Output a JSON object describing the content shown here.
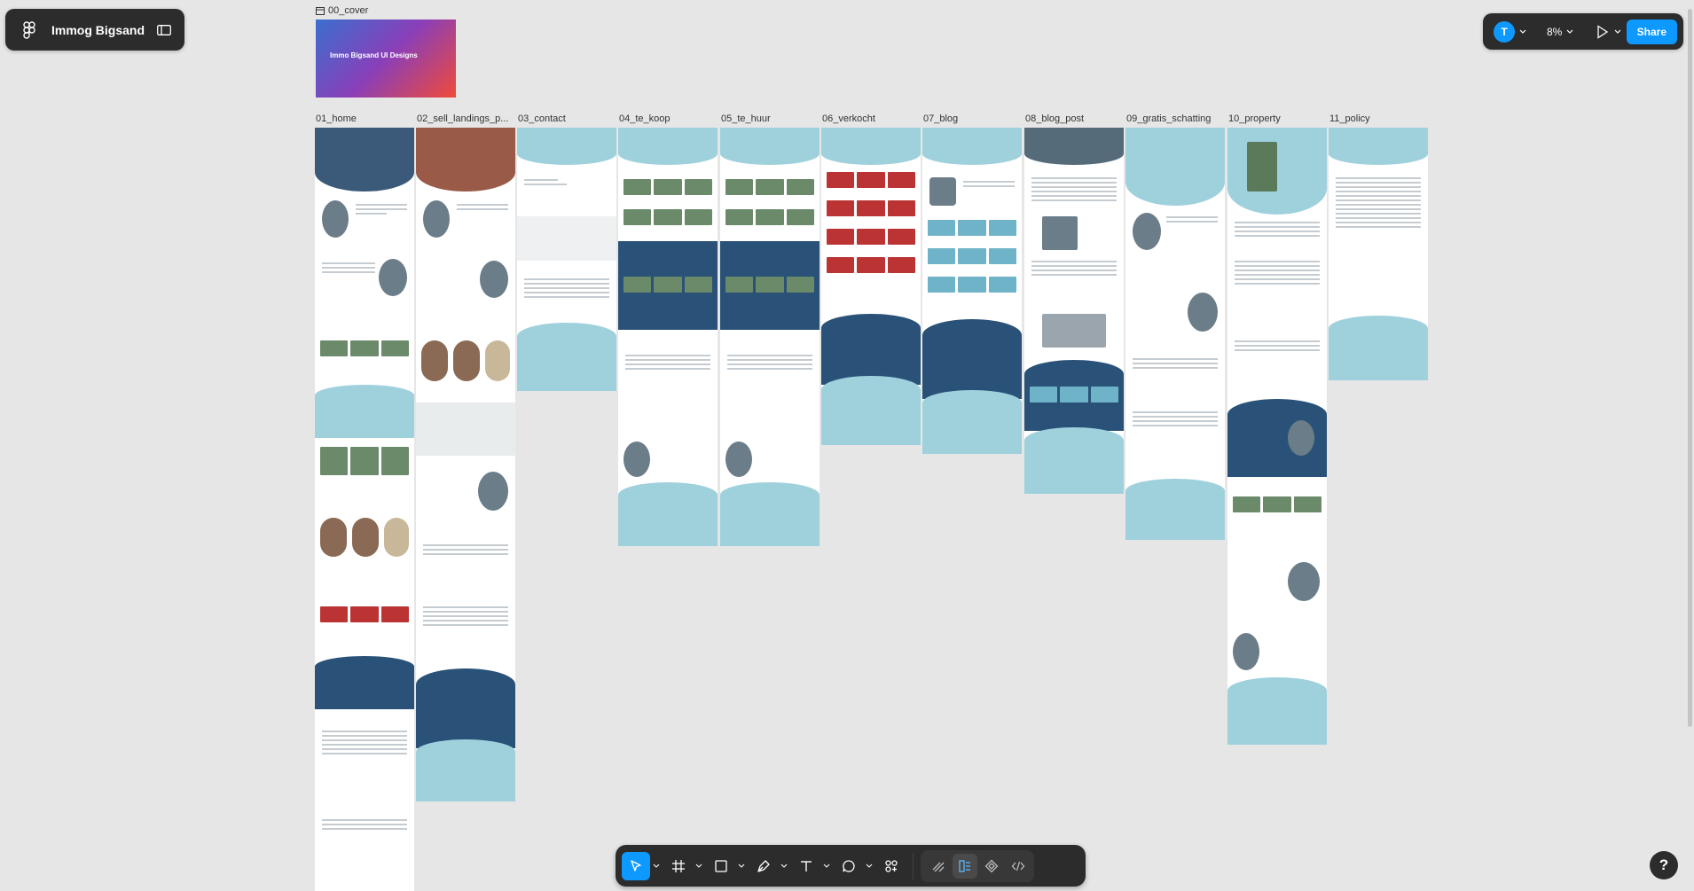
{
  "file": {
    "name": "Immog Bigsand"
  },
  "topbar": {
    "avatar_initial": "T",
    "zoom": "8%",
    "share_label": "Share"
  },
  "cover": {
    "label": "00_cover",
    "title": "Immo Bigsand UI Designs"
  },
  "frames": [
    {
      "label": "01_home"
    },
    {
      "label": "02_sell_landings_p..."
    },
    {
      "label": "03_contact"
    },
    {
      "label": "04_te_koop"
    },
    {
      "label": "05_te_huur"
    },
    {
      "label": "06_verkocht"
    },
    {
      "label": "07_blog"
    },
    {
      "label": "08_blog_post"
    },
    {
      "label": "09_gratis_schatting"
    },
    {
      "label": "10_property"
    },
    {
      "label": "11_policy"
    }
  ],
  "help": {
    "label": "?"
  },
  "colors": {
    "accent": "#0d99ff",
    "panel": "#2c2c2c",
    "canvas": "#e6e6e6",
    "navy": "#2a5278",
    "teal": "#9fd1dd"
  }
}
